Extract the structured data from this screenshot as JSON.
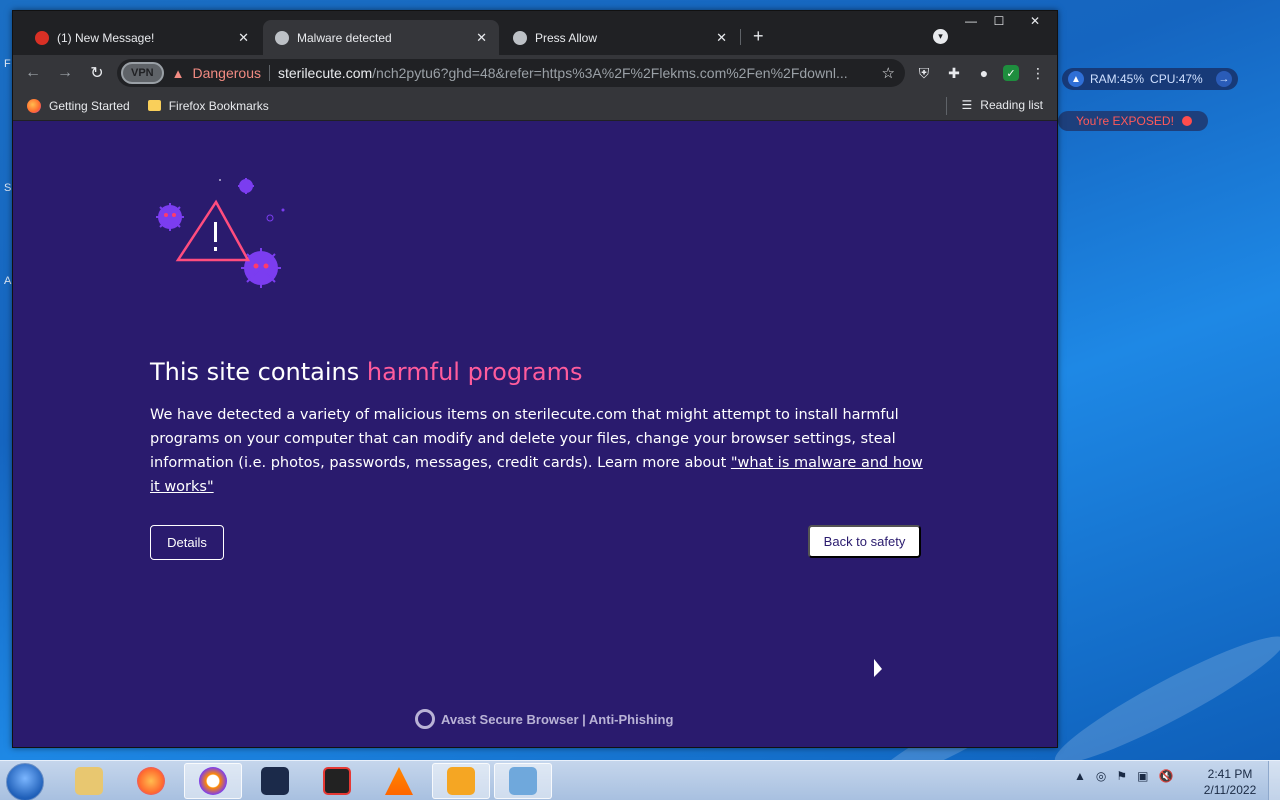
{
  "desktop": {
    "side_letters": [
      "F",
      "S",
      "A"
    ],
    "widget": {
      "ram": "RAM:45%",
      "cpu": "CPU:47%"
    },
    "exposed_text": "You're EXPOSED!"
  },
  "browser": {
    "tabs": [
      {
        "title": "(1) New Message!",
        "icon": "santa-hat-icon",
        "active": false
      },
      {
        "title": "Malware detected",
        "icon": "globe-icon",
        "active": true
      },
      {
        "title": "Press Allow",
        "icon": "globe-icon",
        "active": false
      }
    ],
    "new_tab": "+",
    "toolbar": {
      "vpn_label": "VPN",
      "security_label": "Dangerous",
      "url_domain": "sterilecute.com",
      "url_path": "/nch2pytu6?ghd=48&refer=https%3A%2F%2Flekms.com%2Fen%2Fdownl..."
    },
    "bookmarks": [
      {
        "label": "Getting Started",
        "icon": "firefox-icon"
      },
      {
        "label": "Firefox Bookmarks",
        "icon": "folder-icon"
      }
    ],
    "reading_list": "Reading list"
  },
  "page": {
    "headline_prefix": "This site contains ",
    "headline_highlight": "harmful programs",
    "description": "We have detected a variety of malicious items on sterilecute.com that might attempt to install harmful programs on your computer that can modify and delete your files, change your browser settings, steal information (i.e. photos, passwords, messages, credit cards). Learn more about ",
    "learn_more_link": "\"what is malware and how it works\"",
    "details_button": "Details",
    "safety_button": "Back to safety",
    "footer": "Avast Secure Browser | Anti-Phishing"
  },
  "colors": {
    "page_bg": "#2a1b6e",
    "highlight": "#ff5c9c",
    "danger": "#f28b82"
  },
  "taskbar": {
    "apps": [
      "file-explorer-icon",
      "firefox-icon",
      "avast-browser-icon",
      "shield-icon",
      "screen-recorder-icon",
      "vlc-icon",
      "app-d-icon",
      "network-settings-icon"
    ],
    "time": "2:41 PM",
    "date": "2/11/2022"
  }
}
